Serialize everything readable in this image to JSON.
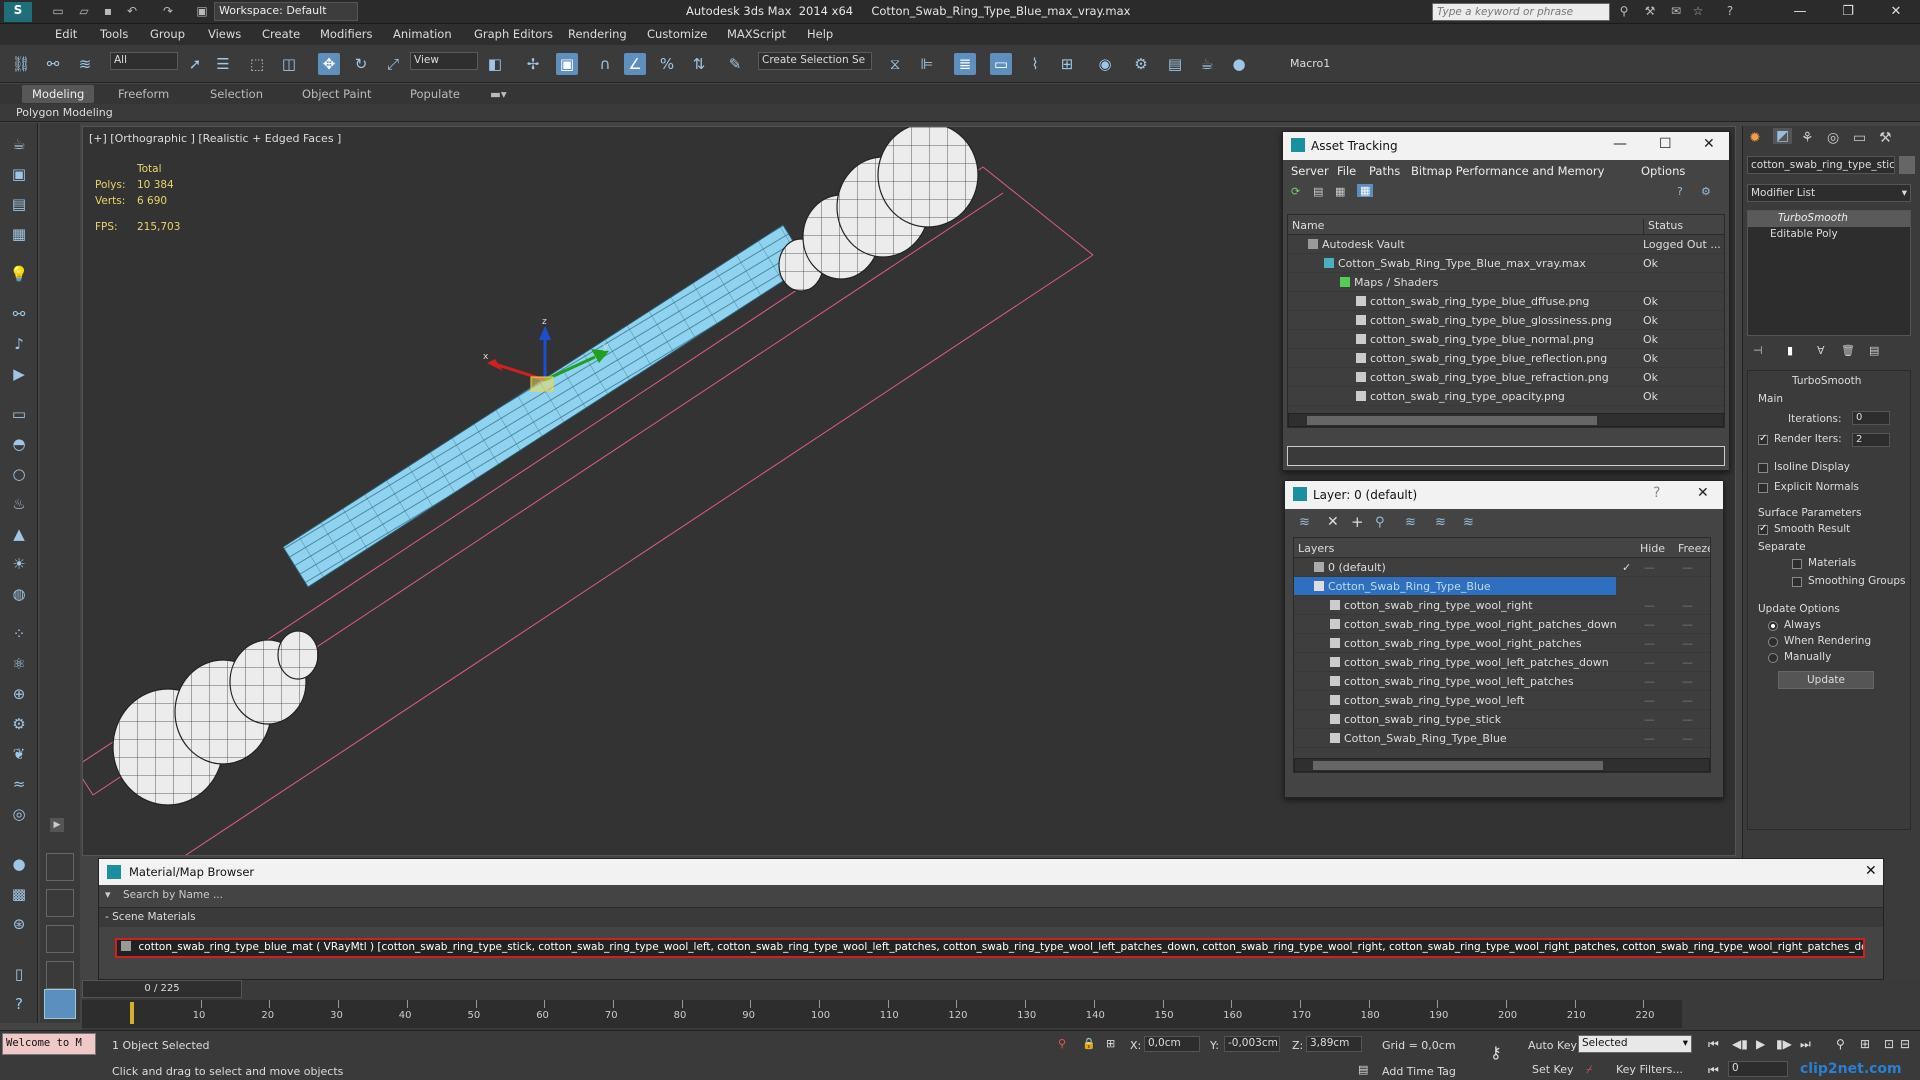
{
  "titlebar": {
    "app_title": "Autodesk 3ds Max  2014 x64     Cotton_Swab_Ring_Type_Blue_max_vray.max",
    "workspace": "Workspace: Default",
    "search_placeholder": "Type a keyword or phrase"
  },
  "menu": [
    "Edit",
    "Tools",
    "Group",
    "Views",
    "Create",
    "Modifiers",
    "Animation",
    "Graph Editors",
    "Rendering",
    "Customize",
    "MAXScript",
    "Help"
  ],
  "toolbar": {
    "selection_filter": "All",
    "ref_coord": "View",
    "named_selection": "Create Selection Se",
    "macro": "Macro1"
  },
  "ribbon": {
    "tabs": [
      "Modeling",
      "Freeform",
      "Selection",
      "Object Paint",
      "Populate"
    ],
    "active_tab": "Modeling",
    "subpanel": "Polygon Modeling"
  },
  "viewport": {
    "label": "[+] [Orthographic ] [Realistic + Edged Faces ]",
    "stats_header": "Total",
    "polys_label": "Polys:",
    "polys": "10 384",
    "verts_label": "Verts:",
    "verts": "6 690",
    "fps_label": "FPS:",
    "fps": "215,703",
    "axes": {
      "x": "x",
      "y": "y",
      "z": "z"
    },
    "colors": {
      "mesh": "#8fd3f0",
      "wire": "#2a2a2a",
      "bound": "#e05a8a"
    }
  },
  "asset_tracking": {
    "title": "Asset Tracking",
    "menu": [
      "Server",
      "File",
      "Paths",
      "Bitmap Performance and Memory",
      "Options"
    ],
    "col_name": "Name",
    "col_status": "Status",
    "rows": [
      {
        "name": "Autodesk Vault",
        "status": "Logged Out ..."
      },
      {
        "name": "Cotton_Swab_Ring_Type_Blue_max_vray.max",
        "status": "Ok"
      },
      {
        "name": "Maps / Shaders",
        "status": ""
      },
      {
        "name": "cotton_swab_ring_type_blue_dffuse.png",
        "status": "Ok"
      },
      {
        "name": "cotton_swab_ring_type_blue_glossiness.png",
        "status": "Ok"
      },
      {
        "name": "cotton_swab_ring_type_blue_normal.png",
        "status": "Ok"
      },
      {
        "name": "cotton_swab_ring_type_blue_reflection.png",
        "status": "Ok"
      },
      {
        "name": "cotton_swab_ring_type_blue_refraction.png",
        "status": "Ok"
      },
      {
        "name": "cotton_swab_ring_type_opacity.png",
        "status": "Ok"
      }
    ]
  },
  "layers": {
    "title": "Layer: 0 (default)",
    "help": "?",
    "col_layers": "Layers",
    "col_hide": "Hide",
    "col_freeze": "Freeze",
    "rows": [
      {
        "name": "0 (default)"
      },
      {
        "name": "Cotton_Swab_Ring_Type_Blue"
      },
      {
        "name": "cotton_swab_ring_type_wool_right"
      },
      {
        "name": "cotton_swab_ring_type_wool_right_patches_down"
      },
      {
        "name": "cotton_swab_ring_type_wool_right_patches"
      },
      {
        "name": "cotton_swab_ring_type_wool_left_patches_down"
      },
      {
        "name": "cotton_swab_ring_type_wool_left_patches"
      },
      {
        "name": "cotton_swab_ring_type_wool_left"
      },
      {
        "name": "cotton_swab_ring_type_stick"
      },
      {
        "name": "Cotton_Swab_Ring_Type_Blue"
      }
    ]
  },
  "command_panel": {
    "object_name": "cotton_swab_ring_type_stick",
    "modifier_list": "Modifier List",
    "stack": [
      "TurboSmooth",
      "Editable Poly"
    ],
    "rollout_title": "TurboSmooth",
    "main": "Main",
    "iterations_label": "Iterations:",
    "iterations": "0",
    "render_iters_label": "Render Iters:",
    "render_iters": "2",
    "isoline": "Isoline Display",
    "explicit_normals": "Explicit Normals",
    "surface_params": "Surface Parameters",
    "smooth_result": "Smooth Result",
    "separate": "Separate",
    "materials": "Materials",
    "smoothing_groups": "Smoothing Groups",
    "update_options": "Update Options",
    "always": "Always",
    "when_rendering": "When Rendering",
    "manually": "Manually",
    "update": "Update"
  },
  "material_browser": {
    "title": "Material/Map Browser",
    "search": "Search by Name ...",
    "section": "- Scene Materials",
    "entry": "cotton_swab_ring_type_blue_mat ( VRayMtl ) [cotton_swab_ring_type_stick, cotton_swab_ring_type_wool_left, cotton_swab_ring_type_wool_left_patches, cotton_swab_ring_type_wool_left_patches_down, cotton_swab_ring_type_wool_right, cotton_swab_ring_type_wool_right_patches, cotton_swab_ring_type_wool_right_patches_down]"
  },
  "timeline": {
    "frame_counter": "0 / 225",
    "ticks": [
      "10",
      "20",
      "30",
      "40",
      "50",
      "60",
      "70",
      "80",
      "90",
      "100",
      "110",
      "120",
      "130",
      "140",
      "150",
      "160",
      "170",
      "180",
      "190",
      "200",
      "210",
      "220"
    ]
  },
  "status": {
    "listener": "Welcome to M",
    "selection": "1 Object Selected",
    "prompt": "Click and drag to select and move objects",
    "x_label": "X:",
    "x": "0,0cm",
    "y_label": "Y:",
    "y": "-0,003cm",
    "z_label": "Z:",
    "z": "3,89cm",
    "grid": "Grid = 0,0cm",
    "add_time_tag": "Add Time Tag",
    "auto_key": "Auto Key",
    "set_key": "Set Key",
    "key_mode": "Selected",
    "key_filters": "Key Filters...",
    "frame": "0",
    "watermark": "clip2net.com"
  }
}
